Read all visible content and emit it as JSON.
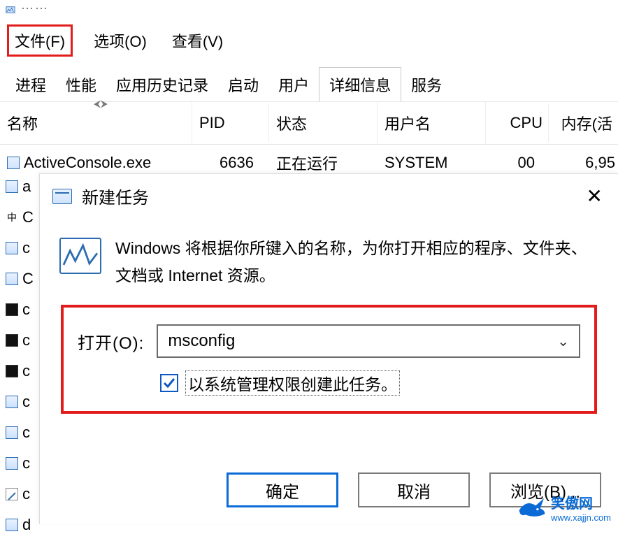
{
  "titlebar": {
    "frag_text": "···"
  },
  "menubar": {
    "file": "文件(F)",
    "options": "选项(O)",
    "view": "查看(V)"
  },
  "tabs": {
    "process": "进程",
    "performance": "性能",
    "app_history": "应用历史记录",
    "startup": "启动",
    "users": "用户",
    "details": "详细信息",
    "services": "服务"
  },
  "columns": {
    "name": "名称",
    "pid": "PID",
    "status": "状态",
    "user": "用户名",
    "cpu": "CPU",
    "mem": "内存(活"
  },
  "rows": [
    {
      "name": "ActiveConsole.exe",
      "pid": "6636",
      "status": "正在运行",
      "user": "SYSTEM",
      "cpu": "00",
      "mem": "6,95"
    }
  ],
  "left_frags": [
    "a",
    "C",
    "c",
    "C",
    "c",
    "c",
    "c",
    "c",
    "c",
    "c",
    "c",
    "d"
  ],
  "dialog": {
    "title": "新建任务",
    "description": "Windows 将根据你所键入的名称，为你打开相应的程序、文件夹、文档或 Internet 资源。",
    "open_label": "打开(O):",
    "open_value": "msconfig",
    "admin_label": "以系统管理权限创建此任务。",
    "admin_checked": true,
    "ok": "确定",
    "cancel": "取消",
    "browse": "浏览(B)..."
  },
  "watermark": {
    "text": "笑傲网",
    "url": "www.xajjn.com"
  }
}
